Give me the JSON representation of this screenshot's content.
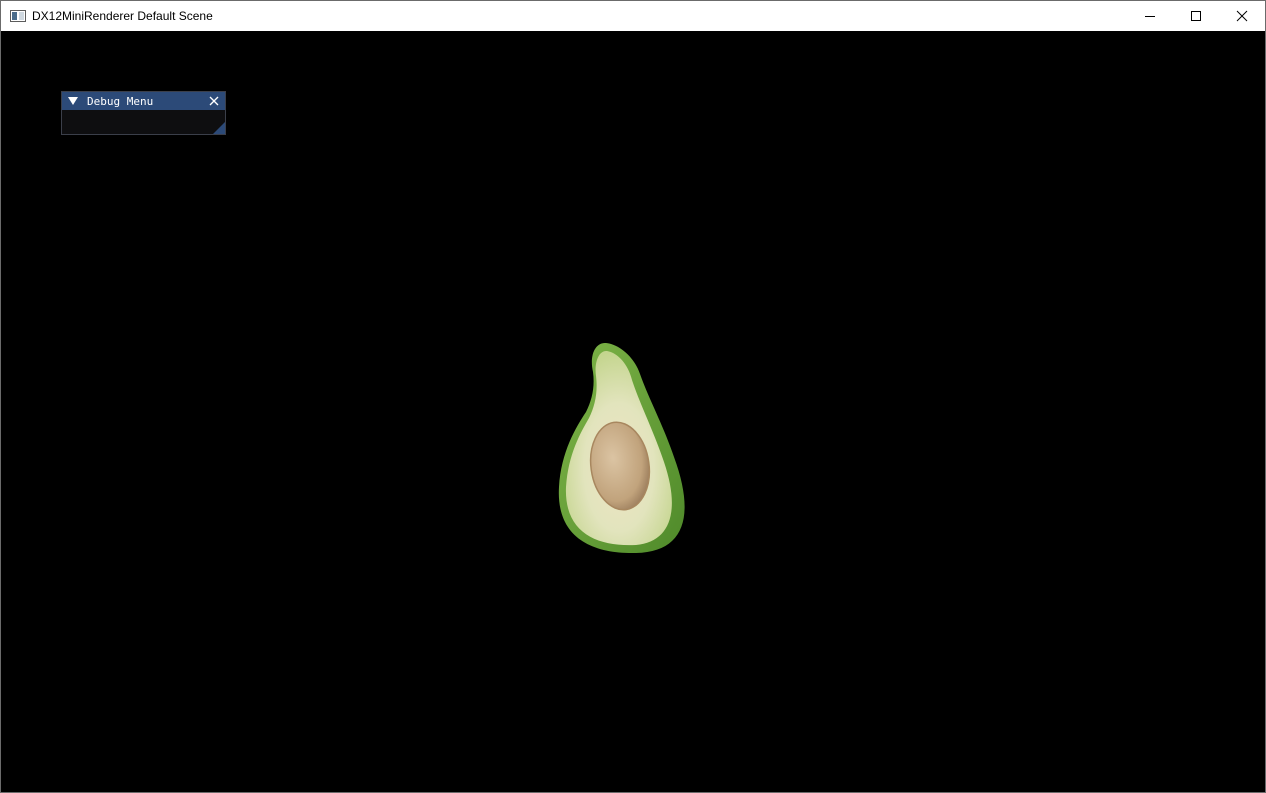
{
  "window": {
    "title": "DX12MiniRenderer Default Scene",
    "caption_buttons": [
      "minimize",
      "maximize",
      "close"
    ]
  },
  "debug_menu": {
    "title": "Debug Menu",
    "collapse_icon": "triangle-down-icon",
    "close_icon": "close-icon"
  },
  "scene": {
    "background_color": "#000000",
    "object": "avocado-half"
  },
  "colors": {
    "imgui_title_bg": "#2c4a78",
    "imgui_window_bg": "#0e0e10",
    "avocado_skin": "#6fa23a",
    "avocado_flesh": "#dfe6b8",
    "avocado_pit": "#c7ab86"
  }
}
